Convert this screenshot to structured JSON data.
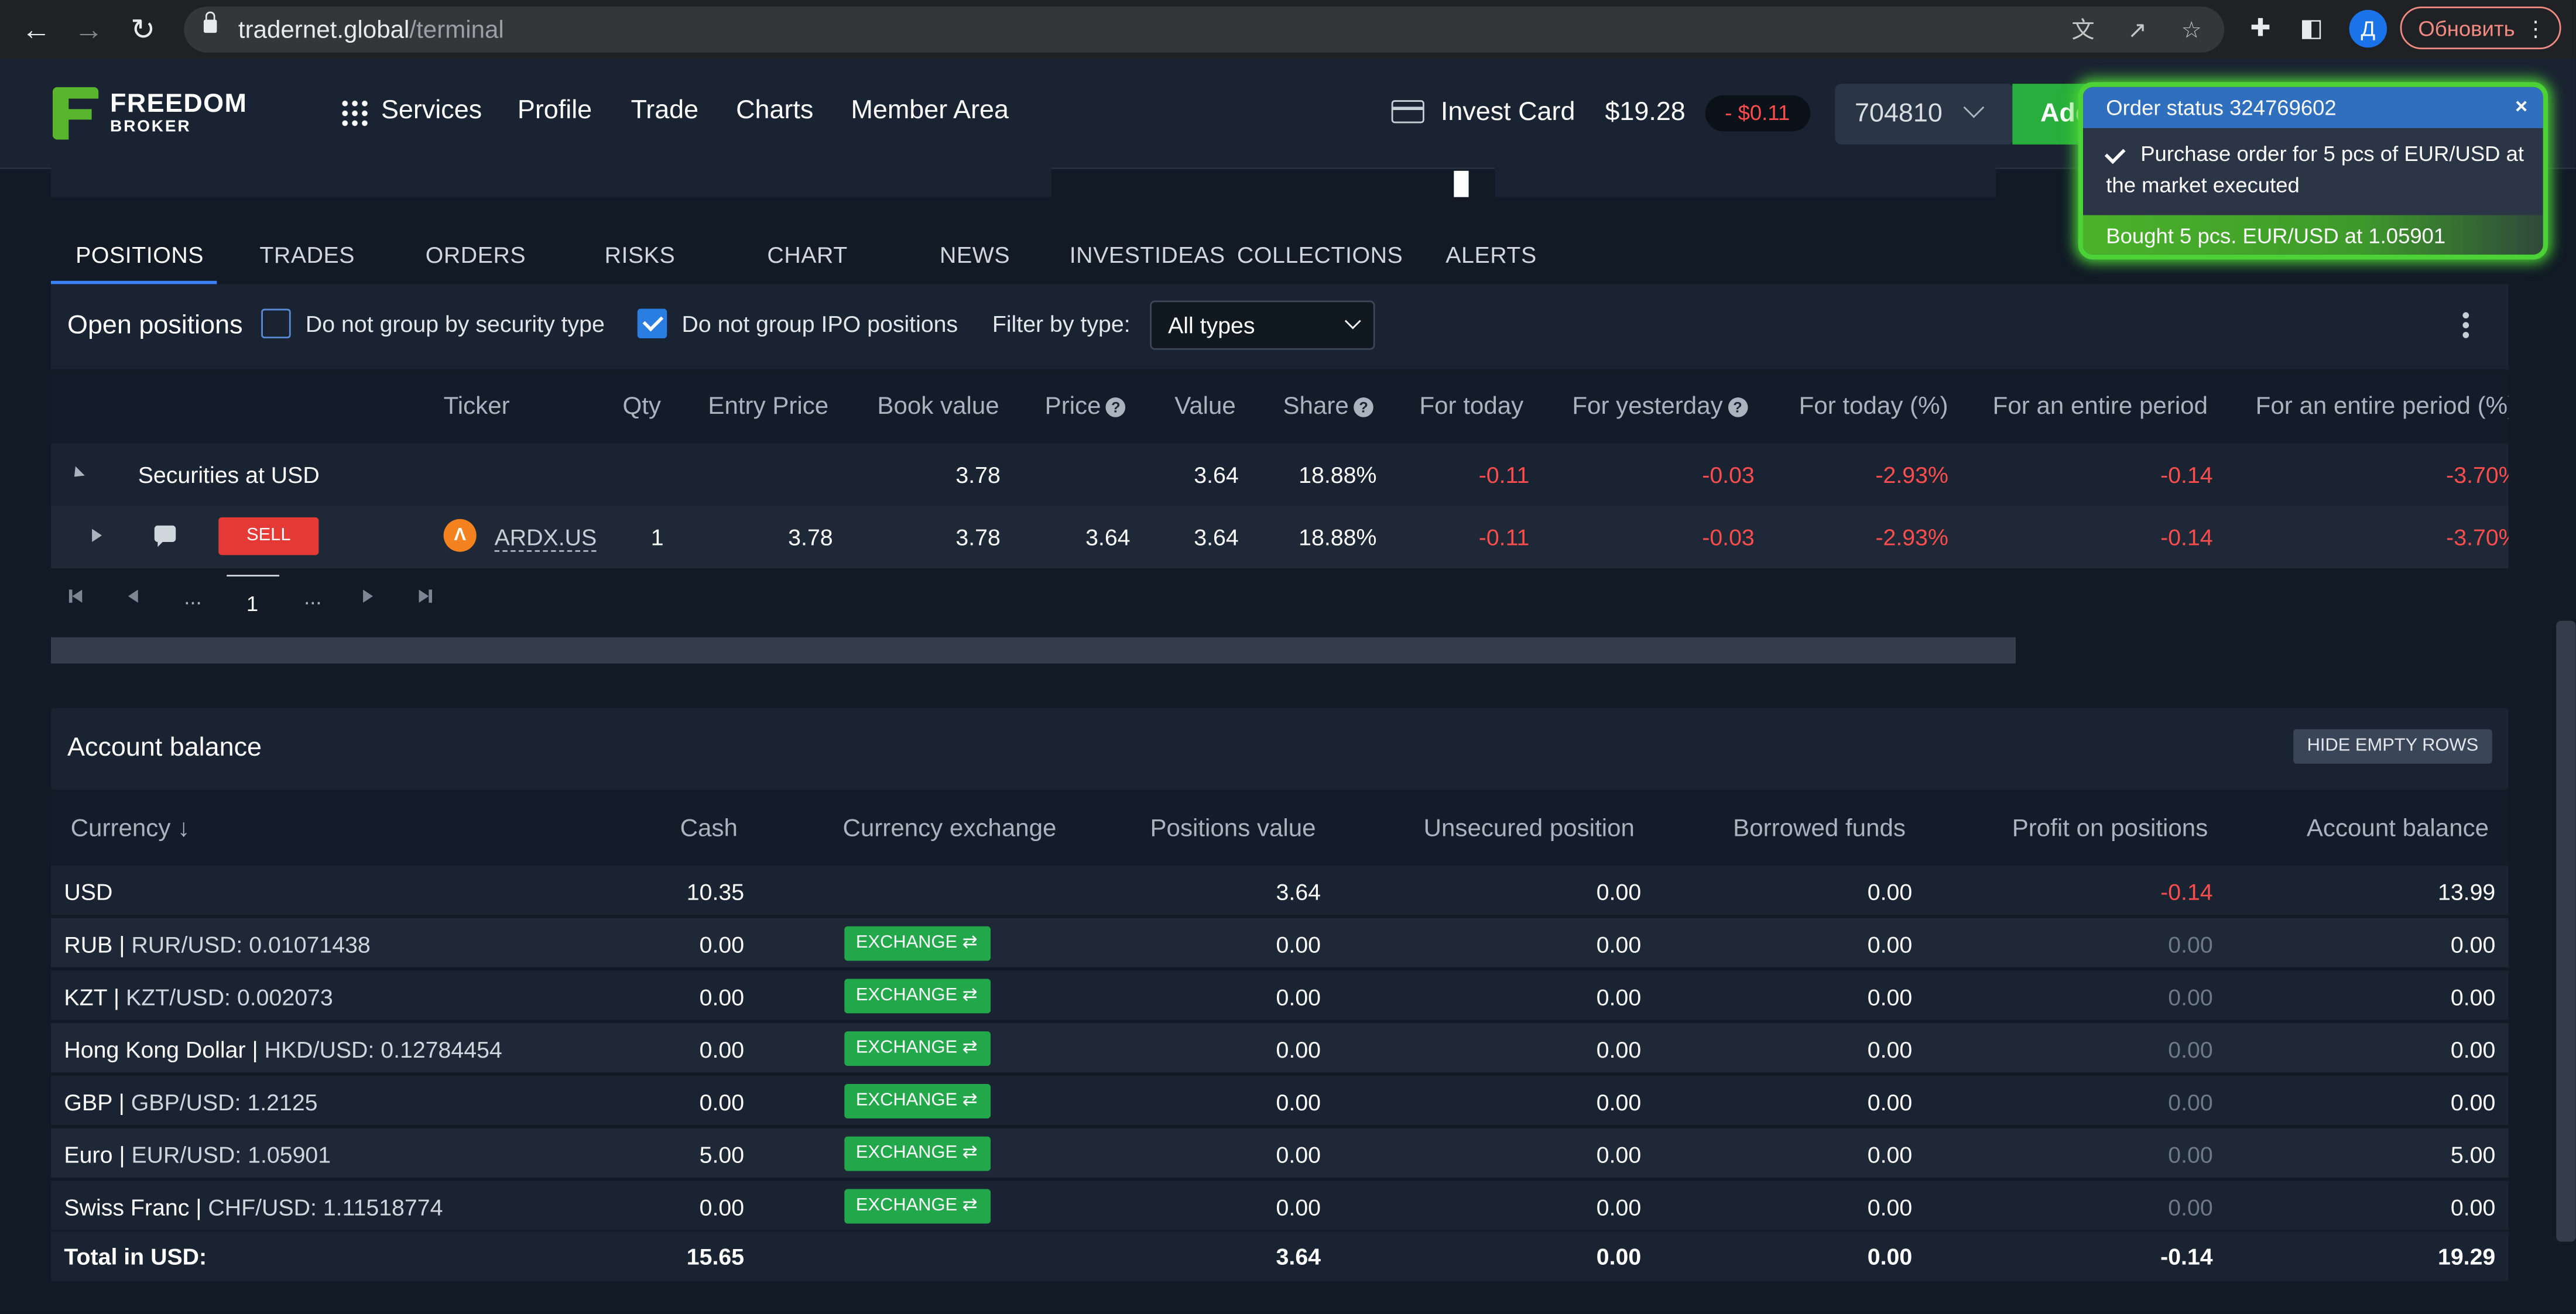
{
  "browser": {
    "url_host": "tradernet.global",
    "url_path": "/terminal",
    "profile_initial": "Д",
    "update_label": "Обновить"
  },
  "header": {
    "logo_line1": "FREEDOM",
    "logo_line2": "BROKER",
    "nav": [
      "Services",
      "Profile",
      "Trade",
      "Charts",
      "Member Area"
    ],
    "invest_card_label": "Invest Card",
    "balance": "$19.28",
    "balance_change": "- $0.11",
    "account_number": "704810",
    "add_button_label": "Add"
  },
  "tabs": [
    "POSITIONS",
    "TRADES",
    "ORDERS",
    "RISKS",
    "CHART",
    "NEWS",
    "INVESTIDEAS",
    "COLLECTIONS",
    "ALERTS"
  ],
  "positions": {
    "title": "Open positions",
    "checkbox1_label": "Do not group by security type",
    "checkbox1_checked": false,
    "checkbox2_label": "Do not group IPO positions",
    "checkbox2_checked": true,
    "filter_label": "Filter by type:",
    "filter_value": "All types",
    "columns": [
      "Ticker",
      "Qty",
      "Entry Price",
      "Book value",
      "Price",
      "Value",
      "Share",
      "For today",
      "For yesterday",
      "For today (%)",
      "For an entire period",
      "For an entire period (%)"
    ],
    "group_row": {
      "label": "Securities at USD",
      "book_value": "3.78",
      "value": "3.64",
      "share": "18.88%",
      "for_today": "-0.11",
      "for_yesterday": "-0.03",
      "for_today_pct": "-2.93%",
      "entire_period": "-0.14",
      "entire_period_pct": "-3.70%"
    },
    "position_row": {
      "sell_label": "SELL",
      "ticker": "ARDX.US",
      "qty": "1",
      "entry_price": "3.78",
      "book_value": "3.78",
      "price": "3.64",
      "value": "3.64",
      "share": "18.88%",
      "for_today": "-0.11",
      "for_yesterday": "-0.03",
      "for_today_pct": "-2.93%",
      "entire_period": "-0.14",
      "entire_period_pct": "-3.70%"
    },
    "pager": {
      "ellipsis_left": "...",
      "current_page": "1",
      "ellipsis_right": "..."
    }
  },
  "balance": {
    "title": "Account balance",
    "hide_empty_label": "HIDE EMPTY ROWS",
    "columns": [
      "Currency",
      "Cash",
      "Currency exchange",
      "Positions value",
      "Unsecured position",
      "Borrowed funds",
      "Profit on positions",
      "Account balance"
    ],
    "exchange_label": "EXCHANGE",
    "rows": [
      {
        "currency": "USD",
        "rate": "",
        "cash": "10.35",
        "exchange": false,
        "positions_value": "3.64",
        "unsecured": "0.00",
        "borrowed": "0.00",
        "profit": "-0.14",
        "profit_style": "red",
        "account_balance": "13.99"
      },
      {
        "currency": "RUB",
        "rate": "RUR/USD: 0.01071438",
        "cash": "0.00",
        "exchange": true,
        "positions_value": "0.00",
        "unsecured": "0.00",
        "borrowed": "0.00",
        "profit": "0.00",
        "profit_style": "grey",
        "account_balance": "0.00"
      },
      {
        "currency": "KZT",
        "rate": "KZT/USD: 0.002073",
        "cash": "0.00",
        "exchange": true,
        "positions_value": "0.00",
        "unsecured": "0.00",
        "borrowed": "0.00",
        "profit": "0.00",
        "profit_style": "grey",
        "account_balance": "0.00"
      },
      {
        "currency": "Hong Kong Dollar",
        "rate": "HKD/USD: 0.12784454",
        "cash": "0.00",
        "exchange": true,
        "positions_value": "0.00",
        "unsecured": "0.00",
        "borrowed": "0.00",
        "profit": "0.00",
        "profit_style": "grey",
        "account_balance": "0.00"
      },
      {
        "currency": "GBP",
        "rate": "GBP/USD: 1.2125",
        "cash": "0.00",
        "exchange": true,
        "positions_value": "0.00",
        "unsecured": "0.00",
        "borrowed": "0.00",
        "profit": "0.00",
        "profit_style": "grey",
        "account_balance": "0.00"
      },
      {
        "currency": "Euro",
        "rate": "EUR/USD: 1.05901",
        "cash": "5.00",
        "exchange": true,
        "positions_value": "0.00",
        "unsecured": "0.00",
        "borrowed": "0.00",
        "profit": "0.00",
        "profit_style": "grey",
        "account_balance": "5.00"
      },
      {
        "currency": "Swiss Franc",
        "rate": "CHF/USD: 1.11518774",
        "cash": "0.00",
        "exchange": true,
        "positions_value": "0.00",
        "unsecured": "0.00",
        "borrowed": "0.00",
        "profit": "0.00",
        "profit_style": "grey",
        "account_balance": "0.00"
      }
    ],
    "total": {
      "label": "Total in USD:",
      "cash": "15.65",
      "positions_value": "3.64",
      "unsecured": "0.00",
      "borrowed": "0.00",
      "profit": "-0.14",
      "account_balance": "19.29"
    }
  },
  "toast": {
    "title": "Order status 324769602",
    "close_label": "×",
    "message": "Purchase order for 5 pcs of EUR/USD at the market executed",
    "footer": "Bought 5 pcs. EUR/USD at 1.05901"
  },
  "colors": {
    "accent_green": "#27ae3c",
    "negative": "#ff4d4d",
    "toast_glow": "#4cd137",
    "tab_underline": "#3b82f6"
  }
}
